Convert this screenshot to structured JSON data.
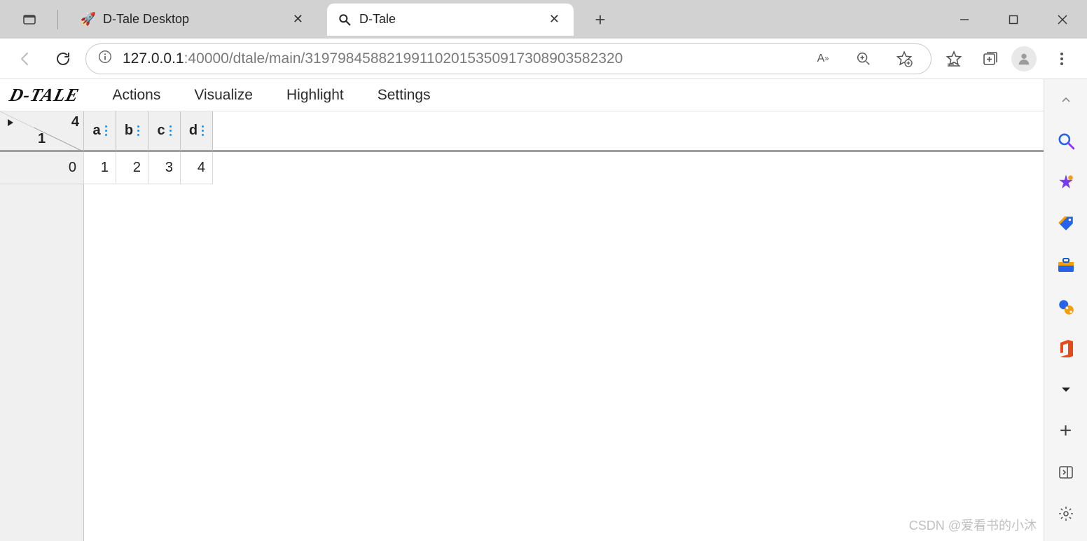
{
  "browser": {
    "tabs": [
      {
        "title": "D-Tale Desktop",
        "active": false
      },
      {
        "title": "D-Tale",
        "active": true
      }
    ],
    "url_host": "127.0.0.1",
    "url_path": ":40000/dtale/main/319798458821991102015350917308903582320"
  },
  "dtale": {
    "logo": "D-TALE",
    "menu": {
      "actions": "Actions",
      "visualize": "Visualize",
      "highlight": "Highlight",
      "settings": "Settings"
    },
    "totals": {
      "cols": "4",
      "rows": "1"
    },
    "columns": [
      "a",
      "b",
      "c",
      "d"
    ],
    "data": [
      {
        "index": "0",
        "values": [
          "1",
          "2",
          "3",
          "4"
        ]
      }
    ]
  },
  "watermark": "CSDN @爱看书的小沐"
}
